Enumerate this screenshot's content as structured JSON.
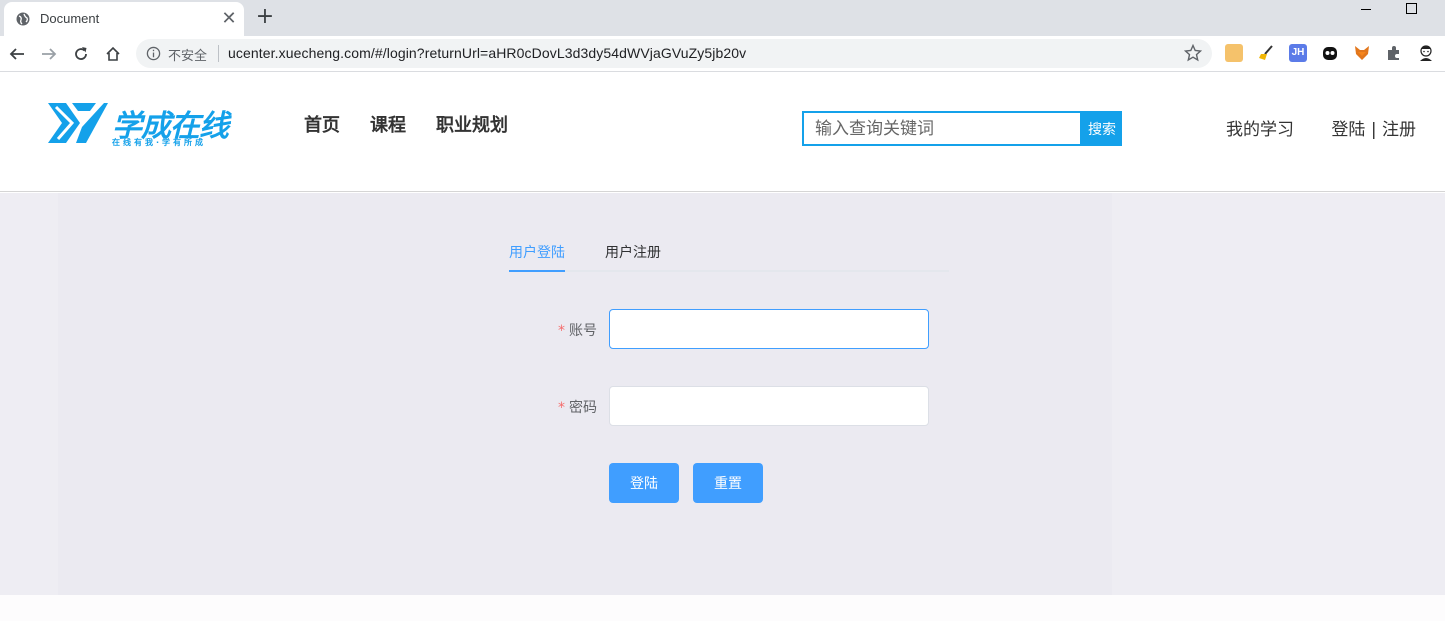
{
  "browser": {
    "tab_title": "Document",
    "tab_close": "✕",
    "new_tab": "+",
    "security_label": "不安全",
    "url": "ucenter.xuecheng.com/#/login?returnUrl=aHR0cDovL3d3dy54dWVjaGVuZy5jb20v",
    "extension_icons": [
      "avatar-ext-icon",
      "broom-ext-icon",
      "jh-ext-icon",
      "ghost-ext-icon",
      "fox-ext-icon",
      "puzzle-icon",
      "profile-avatar-icon"
    ],
    "jh_label": "JH"
  },
  "header": {
    "logo_text": "学成在线",
    "logo_slogan": "在线有我·学有所成",
    "nav": [
      {
        "label": "首页"
      },
      {
        "label": "课程"
      },
      {
        "label": "职业规划"
      }
    ],
    "search_placeholder": "输入查询关键词",
    "search_button": "搜索",
    "my_study": "我的学习",
    "login": "登陆",
    "separator": "|",
    "register": "注册"
  },
  "login": {
    "tabs": [
      {
        "label": "用户登陆",
        "active": true
      },
      {
        "label": "用户注册",
        "active": false
      }
    ],
    "account_label": "账号",
    "password_label": "密码",
    "required_mark": "*",
    "account_value": "",
    "password_value": "",
    "submit_button": "登陆",
    "reset_button": "重置"
  },
  "colors": {
    "brand": "#14a1ea",
    "primary": "#409eff",
    "required": "#f56c6c",
    "content_bg": "#ebeaf1"
  }
}
